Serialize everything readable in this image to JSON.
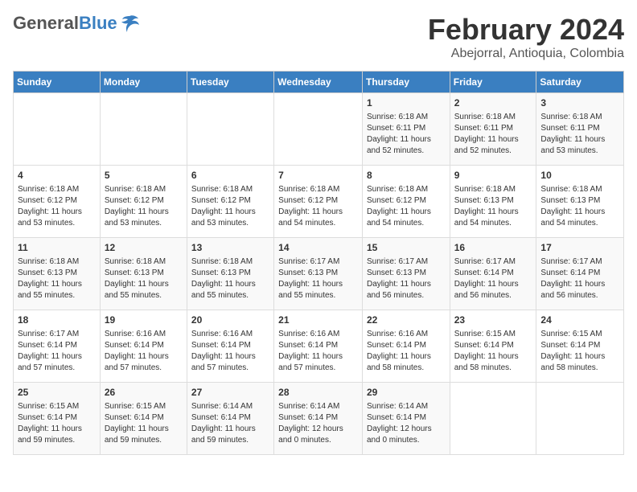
{
  "header": {
    "logo_general": "General",
    "logo_blue": "Blue",
    "month_title": "February 2024",
    "location": "Abejorral, Antioquia, Colombia"
  },
  "days_of_week": [
    "Sunday",
    "Monday",
    "Tuesday",
    "Wednesday",
    "Thursday",
    "Friday",
    "Saturday"
  ],
  "weeks": [
    [
      {
        "day": "",
        "info": ""
      },
      {
        "day": "",
        "info": ""
      },
      {
        "day": "",
        "info": ""
      },
      {
        "day": "",
        "info": ""
      },
      {
        "day": "1",
        "info": "Sunrise: 6:18 AM\nSunset: 6:11 PM\nDaylight: 11 hours\nand 52 minutes."
      },
      {
        "day": "2",
        "info": "Sunrise: 6:18 AM\nSunset: 6:11 PM\nDaylight: 11 hours\nand 52 minutes."
      },
      {
        "day": "3",
        "info": "Sunrise: 6:18 AM\nSunset: 6:11 PM\nDaylight: 11 hours\nand 53 minutes."
      }
    ],
    [
      {
        "day": "4",
        "info": "Sunrise: 6:18 AM\nSunset: 6:12 PM\nDaylight: 11 hours\nand 53 minutes."
      },
      {
        "day": "5",
        "info": "Sunrise: 6:18 AM\nSunset: 6:12 PM\nDaylight: 11 hours\nand 53 minutes."
      },
      {
        "day": "6",
        "info": "Sunrise: 6:18 AM\nSunset: 6:12 PM\nDaylight: 11 hours\nand 53 minutes."
      },
      {
        "day": "7",
        "info": "Sunrise: 6:18 AM\nSunset: 6:12 PM\nDaylight: 11 hours\nand 54 minutes."
      },
      {
        "day": "8",
        "info": "Sunrise: 6:18 AM\nSunset: 6:12 PM\nDaylight: 11 hours\nand 54 minutes."
      },
      {
        "day": "9",
        "info": "Sunrise: 6:18 AM\nSunset: 6:13 PM\nDaylight: 11 hours\nand 54 minutes."
      },
      {
        "day": "10",
        "info": "Sunrise: 6:18 AM\nSunset: 6:13 PM\nDaylight: 11 hours\nand 54 minutes."
      }
    ],
    [
      {
        "day": "11",
        "info": "Sunrise: 6:18 AM\nSunset: 6:13 PM\nDaylight: 11 hours\nand 55 minutes."
      },
      {
        "day": "12",
        "info": "Sunrise: 6:18 AM\nSunset: 6:13 PM\nDaylight: 11 hours\nand 55 minutes."
      },
      {
        "day": "13",
        "info": "Sunrise: 6:18 AM\nSunset: 6:13 PM\nDaylight: 11 hours\nand 55 minutes."
      },
      {
        "day": "14",
        "info": "Sunrise: 6:17 AM\nSunset: 6:13 PM\nDaylight: 11 hours\nand 55 minutes."
      },
      {
        "day": "15",
        "info": "Sunrise: 6:17 AM\nSunset: 6:13 PM\nDaylight: 11 hours\nand 56 minutes."
      },
      {
        "day": "16",
        "info": "Sunrise: 6:17 AM\nSunset: 6:14 PM\nDaylight: 11 hours\nand 56 minutes."
      },
      {
        "day": "17",
        "info": "Sunrise: 6:17 AM\nSunset: 6:14 PM\nDaylight: 11 hours\nand 56 minutes."
      }
    ],
    [
      {
        "day": "18",
        "info": "Sunrise: 6:17 AM\nSunset: 6:14 PM\nDaylight: 11 hours\nand 57 minutes."
      },
      {
        "day": "19",
        "info": "Sunrise: 6:16 AM\nSunset: 6:14 PM\nDaylight: 11 hours\nand 57 minutes."
      },
      {
        "day": "20",
        "info": "Sunrise: 6:16 AM\nSunset: 6:14 PM\nDaylight: 11 hours\nand 57 minutes."
      },
      {
        "day": "21",
        "info": "Sunrise: 6:16 AM\nSunset: 6:14 PM\nDaylight: 11 hours\nand 57 minutes."
      },
      {
        "day": "22",
        "info": "Sunrise: 6:16 AM\nSunset: 6:14 PM\nDaylight: 11 hours\nand 58 minutes."
      },
      {
        "day": "23",
        "info": "Sunrise: 6:15 AM\nSunset: 6:14 PM\nDaylight: 11 hours\nand 58 minutes."
      },
      {
        "day": "24",
        "info": "Sunrise: 6:15 AM\nSunset: 6:14 PM\nDaylight: 11 hours\nand 58 minutes."
      }
    ],
    [
      {
        "day": "25",
        "info": "Sunrise: 6:15 AM\nSunset: 6:14 PM\nDaylight: 11 hours\nand 59 minutes."
      },
      {
        "day": "26",
        "info": "Sunrise: 6:15 AM\nSunset: 6:14 PM\nDaylight: 11 hours\nand 59 minutes."
      },
      {
        "day": "27",
        "info": "Sunrise: 6:14 AM\nSunset: 6:14 PM\nDaylight: 11 hours\nand 59 minutes."
      },
      {
        "day": "28",
        "info": "Sunrise: 6:14 AM\nSunset: 6:14 PM\nDaylight: 12 hours\nand 0 minutes."
      },
      {
        "day": "29",
        "info": "Sunrise: 6:14 AM\nSunset: 6:14 PM\nDaylight: 12 hours\nand 0 minutes."
      },
      {
        "day": "",
        "info": ""
      },
      {
        "day": "",
        "info": ""
      }
    ]
  ]
}
